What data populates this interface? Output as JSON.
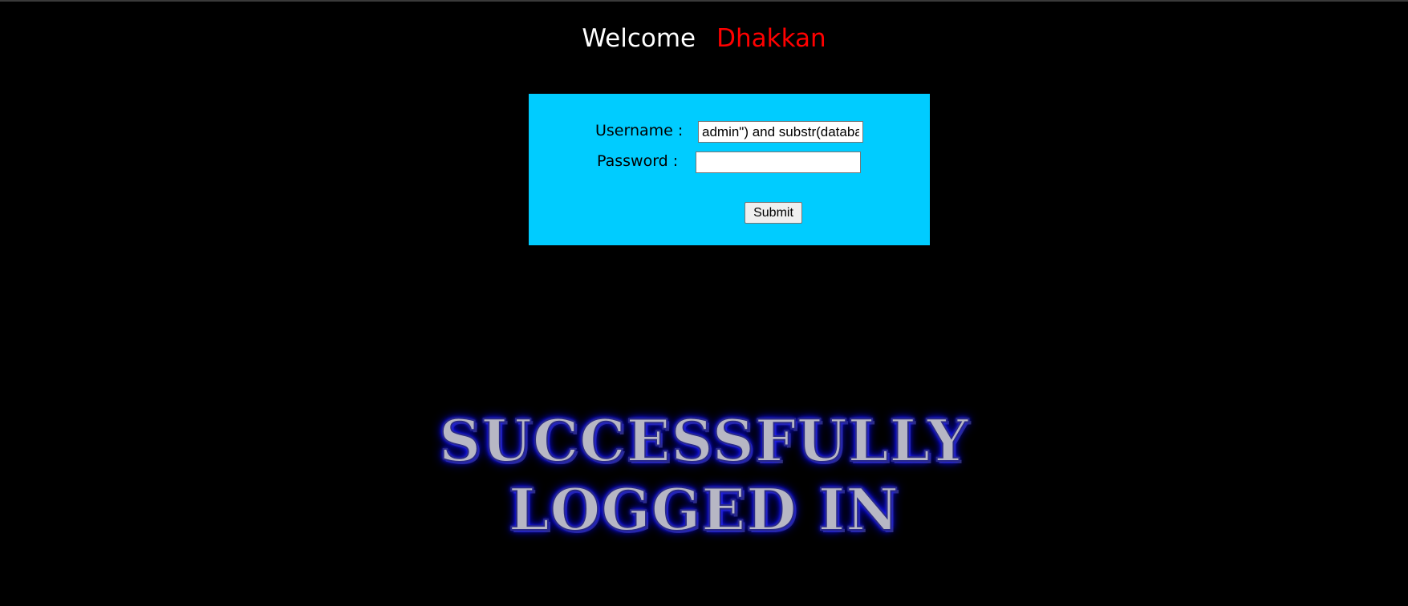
{
  "header": {
    "welcome_word": "Welcome",
    "user_name": "Dhakkan"
  },
  "login_form": {
    "username_label": "Username :",
    "username_value": "admin\") and substr(databa",
    "password_label": "Password :",
    "password_value": "",
    "submit_label": "Submit"
  },
  "banner": {
    "line1": "SUCCESSFULLY",
    "line2": "LOGGED IN"
  },
  "colors": {
    "background": "#000000",
    "form_background": "#00ccff",
    "welcome_text": "#ffffff",
    "user_name_text": "#ff0000",
    "banner_glow": "#0000ff",
    "banner_fill": "#b7b7c4"
  }
}
